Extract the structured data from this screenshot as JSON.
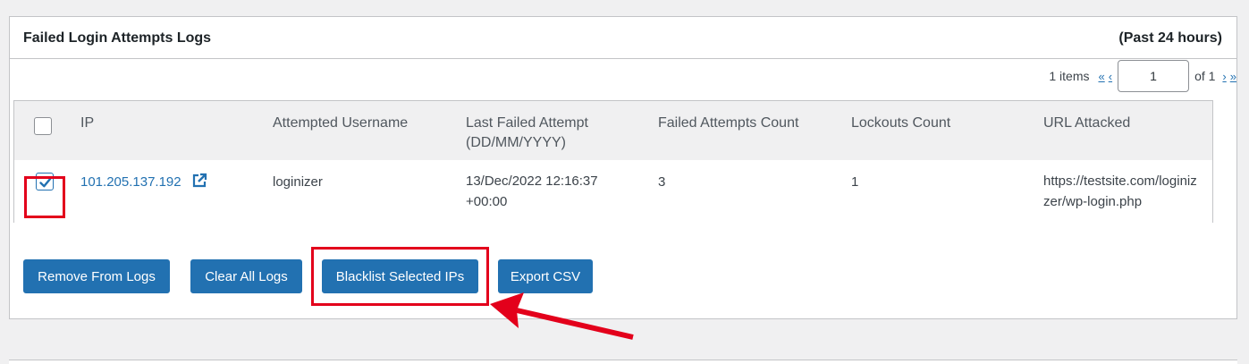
{
  "panel": {
    "title": "Failed Login Attempts Logs",
    "range": "(Past 24 hours)"
  },
  "pager": {
    "items": "1 items",
    "first": "«",
    "prev": "‹",
    "current_page": "1",
    "of": "of 1",
    "next": "›",
    "last": "»"
  },
  "table": {
    "headers": {
      "ip": "IP",
      "username": "Attempted Username",
      "last_attempt_1": "Last Failed Attempt",
      "last_attempt_2": "(DD/MM/YYYY)",
      "failed_count": "Failed Attempts Count",
      "lockouts": "Lockouts Count",
      "url": "URL Attacked"
    },
    "rows": [
      {
        "ip": "101.205.137.192",
        "username": "loginizer",
        "last_attempt_1": "13/Dec/2022 12:16:37",
        "last_attempt_2": "+00:00",
        "failed_count": "3",
        "lockouts": "1",
        "url_1": "https://testsite.com/loginiz",
        "url_2": "zer/wp-login.php",
        "checked": true
      }
    ]
  },
  "buttons": {
    "remove": "Remove From Logs",
    "clear": "Clear All Logs",
    "blacklist": "Blacklist Selected IPs",
    "export": "Export CSV"
  },
  "colors": {
    "accent": "#2271b1",
    "annotation": "#e3001b"
  }
}
